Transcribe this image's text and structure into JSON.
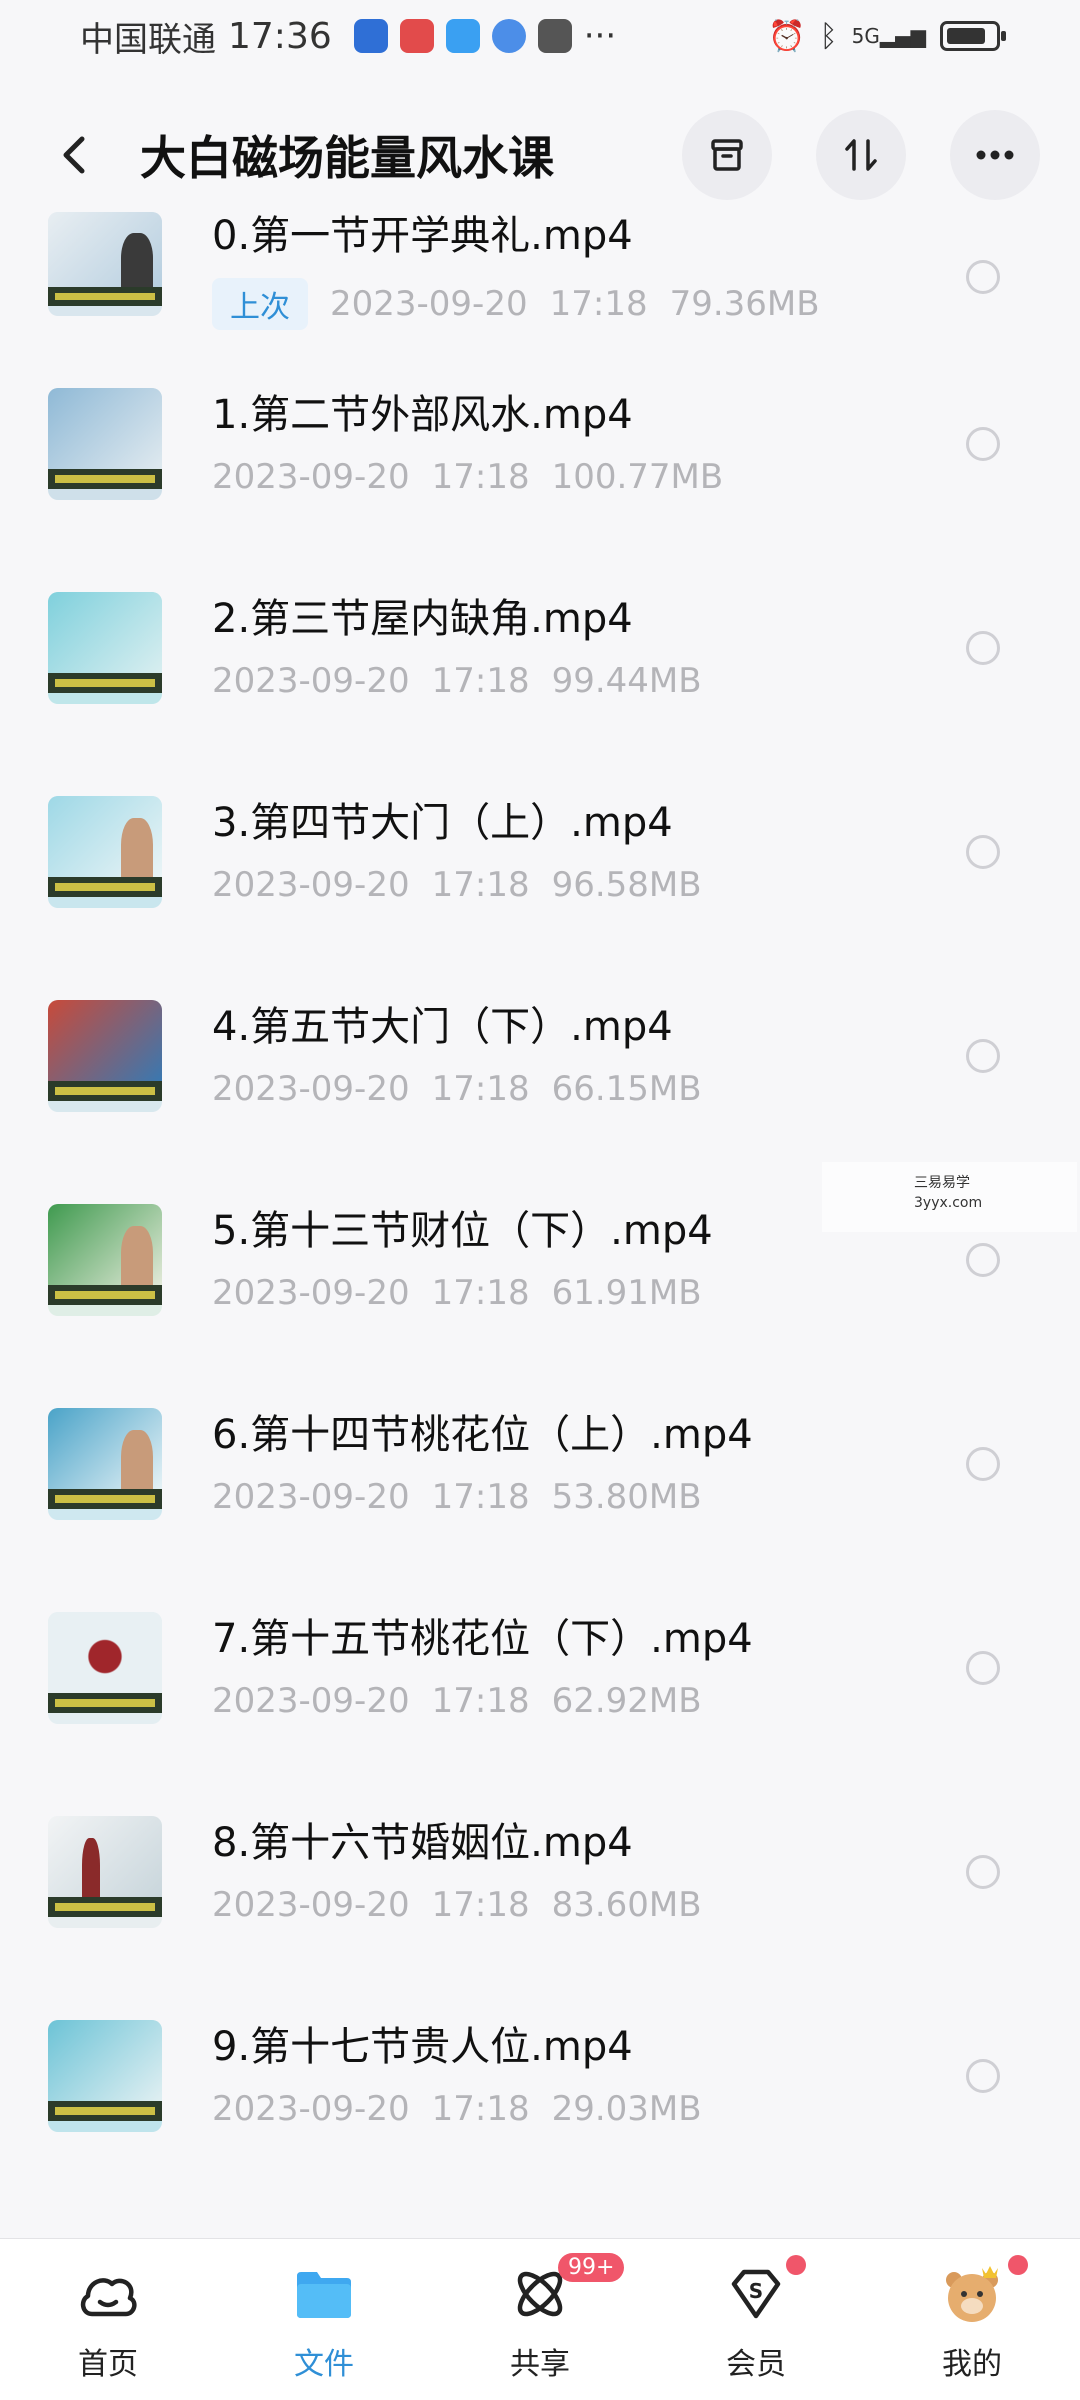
{
  "status_bar": {
    "carrier": "中国联通",
    "time": "17:36",
    "ellipsis": "···",
    "network": "5G"
  },
  "header": {
    "title": "大白磁场能量风水课",
    "icons": [
      "back-icon",
      "archive-icon",
      "sort-icon",
      "more-icon"
    ]
  },
  "files": [
    {
      "name": "0.第一节开学典礼.mp4",
      "tag": "上次",
      "date": "2023-09-20",
      "time": "17:18",
      "size": "79.36MB"
    },
    {
      "name": "1.第二节外部风水.mp4",
      "tag": "",
      "date": "2023-09-20",
      "time": "17:18",
      "size": "100.77MB"
    },
    {
      "name": "2.第三节屋内缺角.mp4",
      "tag": "",
      "date": "2023-09-20",
      "time": "17:18",
      "size": "99.44MB"
    },
    {
      "name": "3.第四节大门（上）.mp4",
      "tag": "",
      "date": "2023-09-20",
      "time": "17:18",
      "size": "96.58MB"
    },
    {
      "name": "4.第五节大门（下）.mp4",
      "tag": "",
      "date": "2023-09-20",
      "time": "17:18",
      "size": "66.15MB"
    },
    {
      "name": "5.第十三节财位（下）.mp4",
      "tag": "",
      "date": "2023-09-20",
      "time": "17:18",
      "size": "61.91MB"
    },
    {
      "name": "6.第十四节桃花位（上）.mp4",
      "tag": "",
      "date": "2023-09-20",
      "time": "17:18",
      "size": "53.80MB"
    },
    {
      "name": "7.第十五节桃花位（下）.mp4",
      "tag": "",
      "date": "2023-09-20",
      "time": "17:18",
      "size": "62.92MB"
    },
    {
      "name": "8.第十六节婚姻位.mp4",
      "tag": "",
      "date": "2023-09-20",
      "time": "17:18",
      "size": "83.60MB"
    },
    {
      "name": "9.第十七节贵人位.mp4",
      "tag": "",
      "date": "2023-09-20",
      "time": "17:18",
      "size": "29.03MB"
    }
  ],
  "watermark": {
    "line1": "三易易学",
    "line2": "3yyx.com"
  },
  "tab_bar": {
    "tabs": [
      {
        "label": "首页",
        "icon": "home-cloud-icon"
      },
      {
        "label": "文件",
        "icon": "folder-icon"
      },
      {
        "label": "共享",
        "icon": "share-orbit-icon",
        "badge": "99+"
      },
      {
        "label": "会员",
        "icon": "vip-diamond-icon"
      },
      {
        "label": "我的",
        "icon": "profile-avatar-icon"
      }
    ],
    "active_color": "#2f8fd6"
  }
}
